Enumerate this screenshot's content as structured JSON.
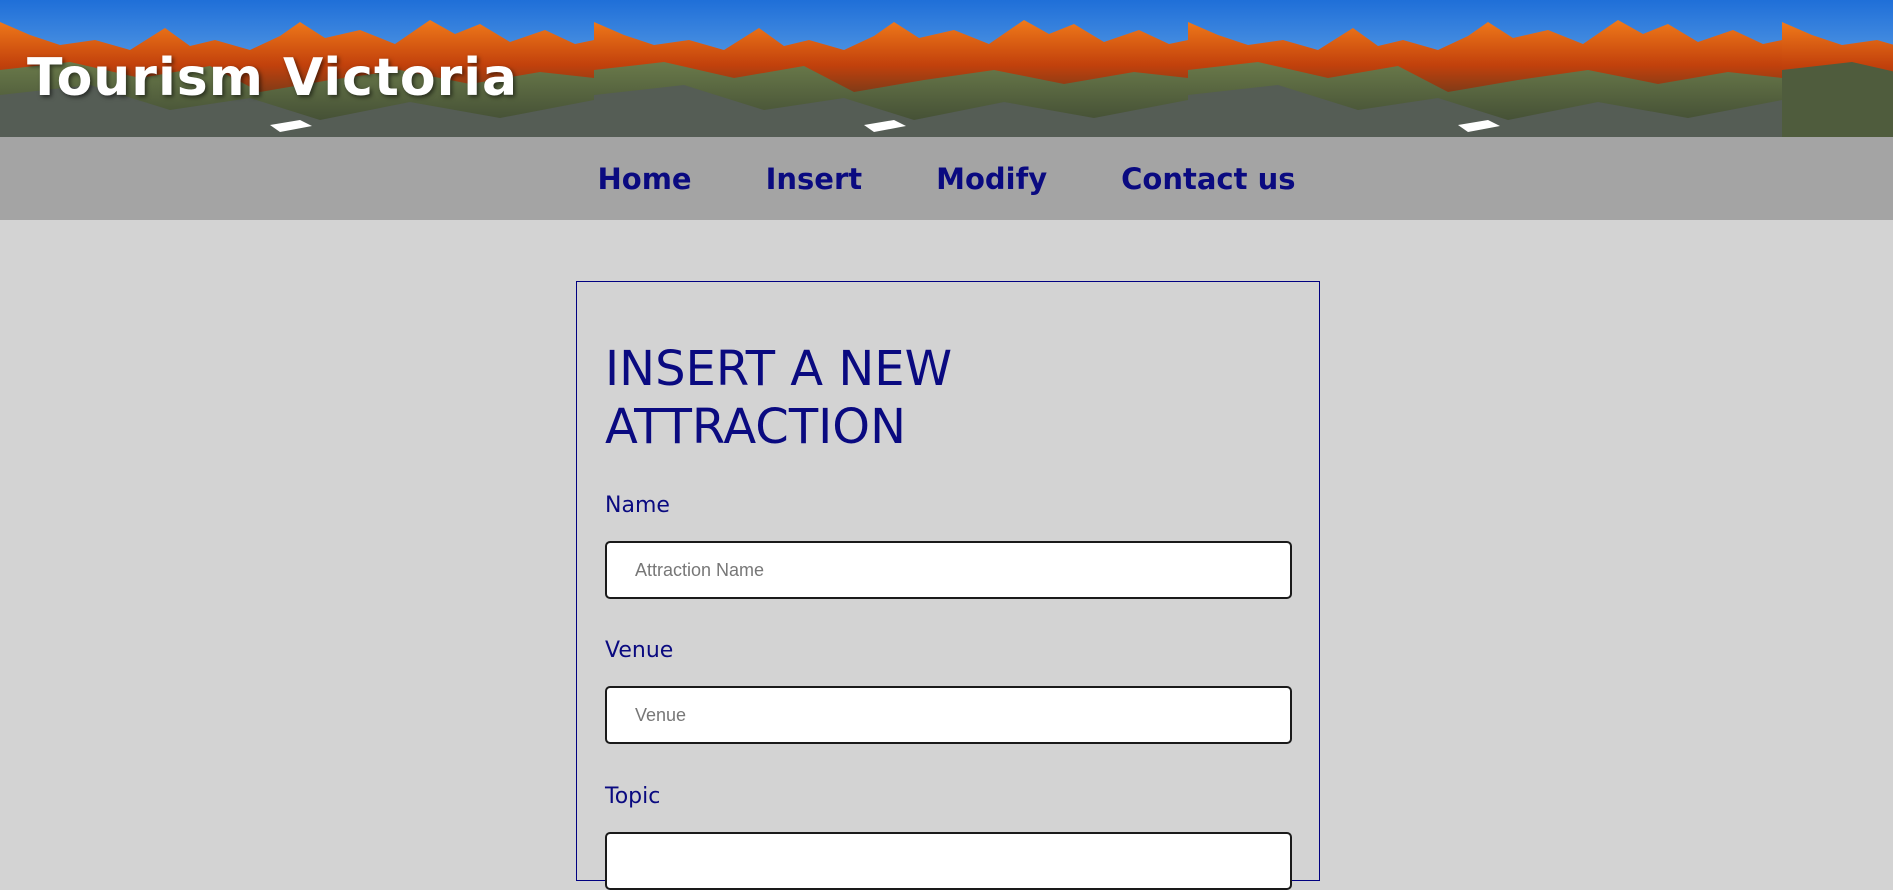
{
  "header": {
    "site_title": "Tourism Victoria"
  },
  "nav": {
    "items": [
      {
        "label": "Home"
      },
      {
        "label": "Insert"
      },
      {
        "label": "Modify"
      },
      {
        "label": "Contact us"
      }
    ]
  },
  "form": {
    "heading": "INSERT A NEW ATTRACTION",
    "fields": [
      {
        "label": "Name",
        "placeholder": "Attraction Name",
        "value": ""
      },
      {
        "label": "Venue",
        "placeholder": "Venue",
        "value": ""
      },
      {
        "label": "Topic",
        "placeholder": "",
        "value": ""
      }
    ]
  },
  "colors": {
    "page_background": "#d3d3d3",
    "nav_background": "#a4a4a4",
    "accent_navy": "#0a0a80",
    "title_white": "#ffffff"
  }
}
